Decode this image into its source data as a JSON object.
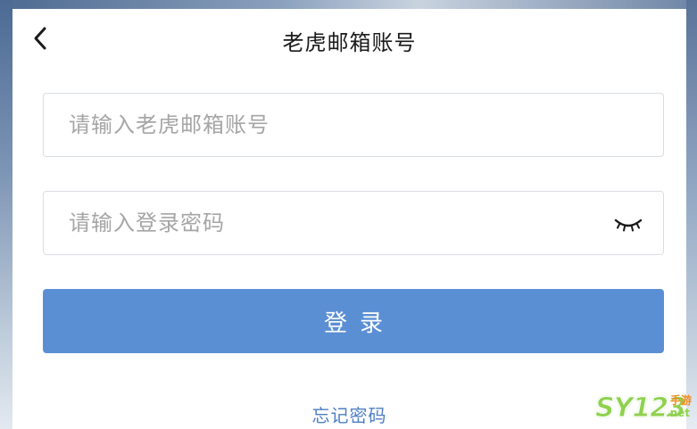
{
  "header": {
    "title": "老虎邮箱账号",
    "back_icon": "chevron-left-icon"
  },
  "form": {
    "account_placeholder": "请输入老虎邮箱账号",
    "account_value": "",
    "password_placeholder": "请输入登录密码",
    "password_value": "",
    "password_toggle_icon": "eye-closed-icon",
    "login_label": "登录",
    "forgot_label": "忘记密码"
  },
  "watermark": {
    "main": "SY123",
    "sub_top": "手游",
    "sub_bottom": ".net"
  },
  "colors": {
    "primary_button": "#5b8fd4",
    "link": "#4d7fc2",
    "title_text": "#1a1a1a",
    "placeholder": "#a5a5a5",
    "field_border": "#d9dde3"
  }
}
